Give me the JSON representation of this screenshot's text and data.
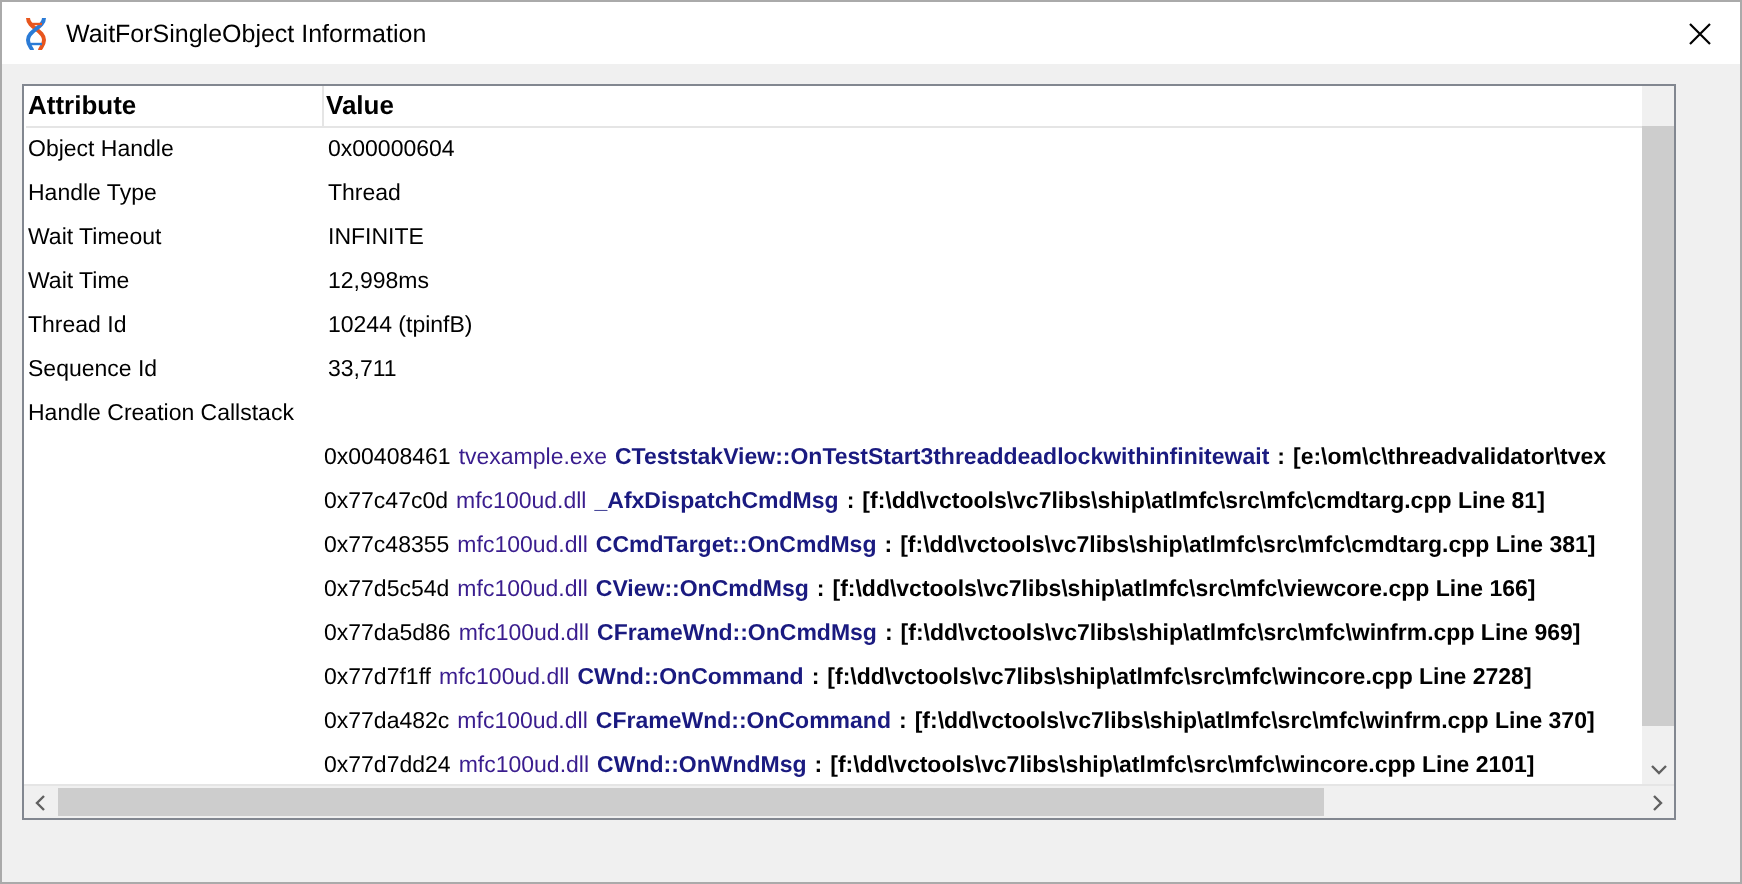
{
  "window": {
    "title": "WaitForSingleObject Information"
  },
  "table": {
    "columns": [
      "Attribute",
      "Value"
    ],
    "rows": [
      {
        "attribute": "Object Handle",
        "value": "0x00000604"
      },
      {
        "attribute": "Handle Type",
        "value": "Thread"
      },
      {
        "attribute": "Wait Timeout",
        "value": "INFINITE"
      },
      {
        "attribute": "Wait Time",
        "value": "12,998ms"
      },
      {
        "attribute": "Thread Id",
        "value": "10244 (tpinfB)"
      },
      {
        "attribute": "Sequence Id",
        "value": "33,711"
      },
      {
        "attribute": "Handle Creation Callstack",
        "value": ""
      }
    ],
    "callstack": [
      {
        "address": "0x00408461",
        "module": "tvexample.exe",
        "function": "CTeststakView::OnTestStart3threaddeadlockwithinfinitewait",
        "separator": ":",
        "location": "[e:\\om\\c\\threadvalidator\\tvex"
      },
      {
        "address": "0x77c47c0d",
        "module": "mfc100ud.dll",
        "function": "_AfxDispatchCmdMsg",
        "separator": ":",
        "location": "[f:\\dd\\vctools\\vc7libs\\ship\\atlmfc\\src\\mfc\\cmdtarg.cpp Line 81]"
      },
      {
        "address": "0x77c48355",
        "module": "mfc100ud.dll",
        "function": "CCmdTarget::OnCmdMsg",
        "separator": ":",
        "location": "[f:\\dd\\vctools\\vc7libs\\ship\\atlmfc\\src\\mfc\\cmdtarg.cpp Line 381]"
      },
      {
        "address": "0x77d5c54d",
        "module": "mfc100ud.dll",
        "function": "CView::OnCmdMsg",
        "separator": ":",
        "location": "[f:\\dd\\vctools\\vc7libs\\ship\\atlmfc\\src\\mfc\\viewcore.cpp Line 166]"
      },
      {
        "address": "0x77da5d86",
        "module": "mfc100ud.dll",
        "function": "CFrameWnd::OnCmdMsg",
        "separator": ":",
        "location": "[f:\\dd\\vctools\\vc7libs\\ship\\atlmfc\\src\\mfc\\winfrm.cpp Line 969]"
      },
      {
        "address": "0x77d7f1ff",
        "module": "mfc100ud.dll",
        "function": "CWnd::OnCommand",
        "separator": ":",
        "location": "[f:\\dd\\vctools\\vc7libs\\ship\\atlmfc\\src\\mfc\\wincore.cpp Line 2728]"
      },
      {
        "address": "0x77da482c",
        "module": "mfc100ud.dll",
        "function": "CFrameWnd::OnCommand",
        "separator": ":",
        "location": "[f:\\dd\\vctools\\vc7libs\\ship\\atlmfc\\src\\mfc\\winfrm.cpp Line 370]"
      },
      {
        "address": "0x77d7dd24",
        "module": "mfc100ud.dll",
        "function": "CWnd::OnWndMsg",
        "separator": ":",
        "location": "[f:\\dd\\vctools\\vc7libs\\ship\\atlmfc\\src\\mfc\\wincore.cpp Line 2101]"
      }
    ]
  }
}
